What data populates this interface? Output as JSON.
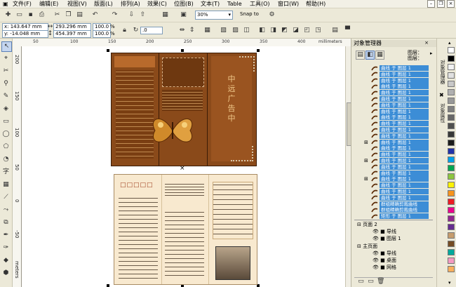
{
  "menu": [
    "文件(F)",
    "编辑(E)",
    "视图(V)",
    "版面(L)",
    "排列(A)",
    "效果(C)",
    "位图(B)",
    "文本(T)",
    "Table",
    "工具(O)",
    "窗口(W)",
    "帮助(H)"
  ],
  "toolbar": {
    "zoom": "30%",
    "snap_label": "Snap to"
  },
  "property_bar": {
    "x": "x: 143.647 mm",
    "y": "y: -14.048 mm",
    "width": "293.296 mm",
    "height": "454.397 mm",
    "scale_x": "100.0",
    "scale_y": "100.0",
    "percent": "%",
    "rotation": ".0"
  },
  "ruler": {
    "top_ticks": [
      "50",
      "100",
      "150",
      "200",
      "250",
      "300",
      "350",
      "400",
      "450"
    ],
    "unit": "millimeters",
    "left_ticks": [
      "200",
      "150",
      "100",
      "50",
      "0",
      "-50",
      "-100"
    ],
    "left_unit": "meters"
  },
  "docker": {
    "title": "对象管理器",
    "header": [
      "图层：",
      "图层："
    ],
    "layer_label": "曲线 于 图层 1",
    "layer_rows": [
      "曲线 于 图层 1",
      "曲线 于 图层 1",
      "曲线 于 图层 1",
      "曲线 于 图层 1",
      "曲线 于 图层 1",
      "曲线 于 图层 1",
      "曲线 于 图层 1",
      "曲线 于 图层 1",
      "曲线 于 图层 1",
      "曲线 于 图层 1",
      "曲线 于 图层 1",
      "曲线 于 图层 1",
      "曲线 于 图层 1",
      "曲线 于 图层 1",
      "曲线 于 图层 1",
      "曲线 于 图层 1",
      "曲线 于 图层 1",
      "曲线 于 图层 1",
      "曲线 于 图层 1",
      "曲线 于 图层 1",
      "曲线 于 图层 1",
      "曲线 于 图层 1",
      "群组精确剪裁曲线",
      "群组精确剪裁曲线",
      "矩形 于 图层 1"
    ],
    "page2": "页面 2",
    "page2_layers": [
      "导线",
      "图层 1"
    ],
    "master": "主页面",
    "master_layers": [
      "导线",
      "桌面",
      "网格"
    ]
  },
  "side_strip": {
    "tab1": "对象管理器",
    "tab2": "对象属性"
  },
  "brochure": {
    "title_chars": [
      "中",
      "远",
      "广",
      "告",
      "中"
    ],
    "inside_heading": "□□□□□"
  },
  "palette": [
    "#ffffff",
    "#000000",
    "#f0f0f0",
    "#e0e0e0",
    "#c8c8c8",
    "#b0b0b0",
    "#989898",
    "#808080",
    "#686868",
    "#505050",
    "#383838",
    "#1c1c1c",
    "#2233aa",
    "#00a0e9",
    "#00a651",
    "#8dc63f",
    "#fff200",
    "#f7941d",
    "#ed1c24",
    "#ec008c",
    "#92278f",
    "#662d91",
    "#c69c6d",
    "#754c24",
    "#00a99d",
    "#f49ac2",
    "#fbaf5d"
  ]
}
